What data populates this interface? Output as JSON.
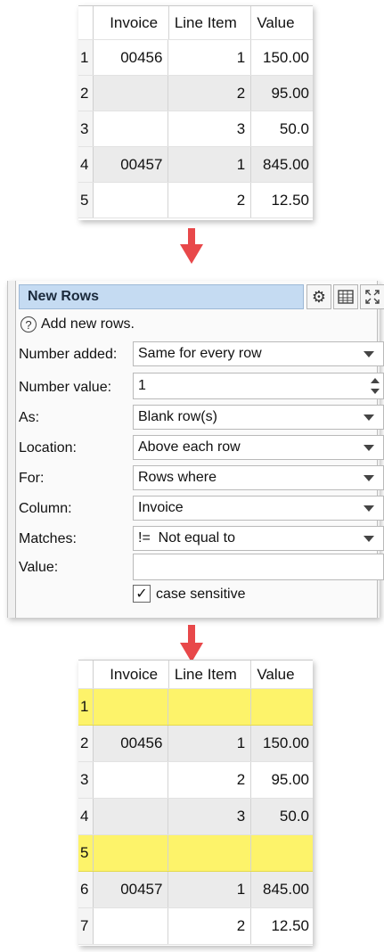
{
  "top_table": {
    "headers": [
      "Invoice",
      "Line Item",
      "Value"
    ],
    "rows": [
      {
        "n": "1",
        "invoice": "00456",
        "line": "1",
        "value": "150.00"
      },
      {
        "n": "2",
        "invoice": "",
        "line": "2",
        "value": "95.00"
      },
      {
        "n": "3",
        "invoice": "",
        "line": "3",
        "value": "50.0"
      },
      {
        "n": "4",
        "invoice": "00457",
        "line": "1",
        "value": "845.00"
      },
      {
        "n": "5",
        "invoice": "",
        "line": "2",
        "value": "12.50"
      }
    ]
  },
  "panel": {
    "title": "New Rows",
    "icons": {
      "settings": "gears-icon",
      "table": "table-icon",
      "maximize": "maximize-icon"
    },
    "help_text": "Add new rows.",
    "fields": {
      "number_added": {
        "label": "Number added:",
        "value": "Same for every row"
      },
      "number_value": {
        "label": "Number value:",
        "value": "1"
      },
      "as": {
        "label": "As:",
        "value": "Blank row(s)"
      },
      "location": {
        "label": "Location:",
        "value": "Above each row"
      },
      "for": {
        "label": "For:",
        "value": "Rows where"
      },
      "column": {
        "label": "Column:",
        "value": "Invoice"
      },
      "matches": {
        "label": "Matches:",
        "value": "!=  Not equal to"
      },
      "value": {
        "label": "Value:",
        "value": ""
      }
    },
    "case_sensitive": {
      "label": "case sensitive",
      "checked": true
    }
  },
  "bottom_table": {
    "headers": [
      "Invoice",
      "Line Item",
      "Value"
    ],
    "rows": [
      {
        "n": "1",
        "invoice": "",
        "line": "",
        "value": "",
        "new": true
      },
      {
        "n": "2",
        "invoice": "00456",
        "line": "1",
        "value": "150.00"
      },
      {
        "n": "3",
        "invoice": "",
        "line": "2",
        "value": "95.00"
      },
      {
        "n": "4",
        "invoice": "",
        "line": "3",
        "value": "50.0"
      },
      {
        "n": "5",
        "invoice": "",
        "line": "",
        "value": "",
        "new": true
      },
      {
        "n": "6",
        "invoice": "00457",
        "line": "1",
        "value": "845.00"
      },
      {
        "n": "7",
        "invoice": "",
        "line": "2",
        "value": "12.50"
      }
    ]
  },
  "colors": {
    "accent_arrow": "#e8484a",
    "highlight_row": "#fdf36a",
    "title_bg": "#c5dbf2"
  }
}
